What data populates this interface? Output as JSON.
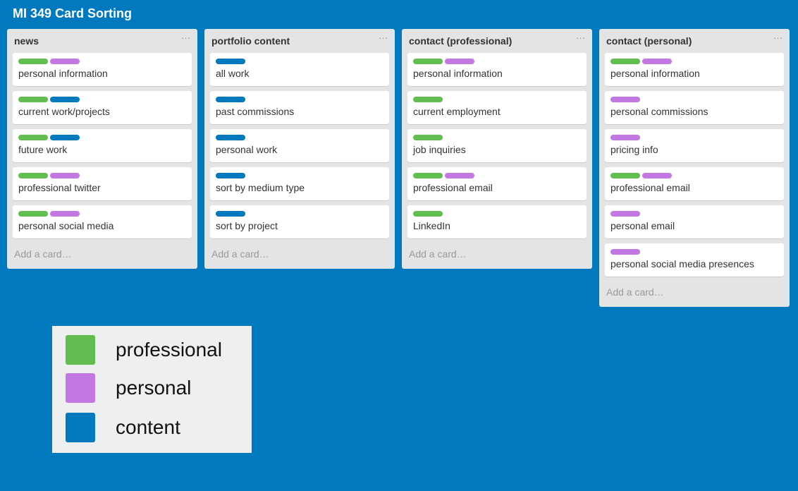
{
  "board": {
    "title": "MI 349 Card Sorting"
  },
  "colors": {
    "background": "#0079bf",
    "professional": "#61bd4f",
    "personal": "#c377e0",
    "content": "#0079bf"
  },
  "lists": [
    {
      "title": "news",
      "menu": "···",
      "add_card": "Add a card…",
      "cards": [
        {
          "text": "personal information",
          "labels": [
            "professional",
            "personal"
          ]
        },
        {
          "text": "current work/projects",
          "labels": [
            "professional",
            "content"
          ]
        },
        {
          "text": "future work",
          "labels": [
            "professional",
            "content"
          ]
        },
        {
          "text": "professional twitter",
          "labels": [
            "professional",
            "personal"
          ]
        },
        {
          "text": "personal social media",
          "labels": [
            "professional",
            "personal"
          ]
        }
      ]
    },
    {
      "title": "portfolio content",
      "menu": "···",
      "add_card": "Add a card…",
      "cards": [
        {
          "text": "all work",
          "labels": [
            "content"
          ]
        },
        {
          "text": "past commissions",
          "labels": [
            "content"
          ]
        },
        {
          "text": "personal work",
          "labels": [
            "content"
          ]
        },
        {
          "text": "sort by medium type",
          "labels": [
            "content"
          ]
        },
        {
          "text": "sort by project",
          "labels": [
            "content"
          ]
        }
      ]
    },
    {
      "title": "contact (professional)",
      "menu": "···",
      "add_card": "Add a card…",
      "cards": [
        {
          "text": "personal information",
          "labels": [
            "professional",
            "personal"
          ]
        },
        {
          "text": "current employment",
          "labels": [
            "professional"
          ]
        },
        {
          "text": "job inquiries",
          "labels": [
            "professional"
          ]
        },
        {
          "text": "professional email",
          "labels": [
            "professional",
            "personal"
          ]
        },
        {
          "text": "LinkedIn",
          "labels": [
            "professional"
          ]
        }
      ]
    },
    {
      "title": "contact (personal)",
      "menu": "···",
      "add_card": "Add a card…",
      "cards": [
        {
          "text": "personal information",
          "labels": [
            "professional",
            "personal"
          ]
        },
        {
          "text": "personal commissions",
          "labels": [
            "personal"
          ]
        },
        {
          "text": "pricing info",
          "labels": [
            "personal"
          ]
        },
        {
          "text": "professional email",
          "labels": [
            "professional",
            "personal"
          ]
        },
        {
          "text": "personal email",
          "labels": [
            "personal"
          ]
        },
        {
          "text": "personal social media presences",
          "labels": [
            "personal"
          ]
        }
      ]
    }
  ],
  "legend": {
    "items": [
      {
        "key": "professional",
        "text": "professional"
      },
      {
        "key": "personal",
        "text": "personal"
      },
      {
        "key": "content",
        "text": "content"
      }
    ]
  }
}
